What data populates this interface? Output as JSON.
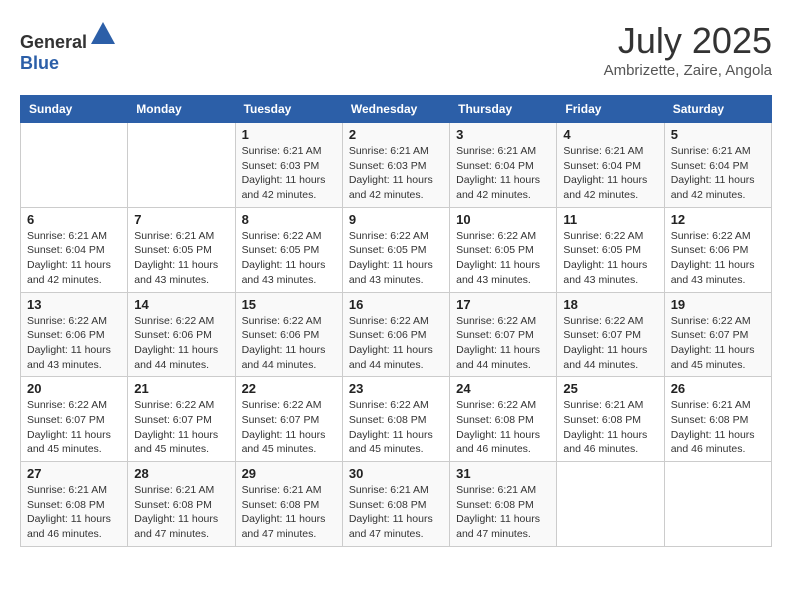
{
  "header": {
    "logo_general": "General",
    "logo_blue": "Blue",
    "month_year": "July 2025",
    "location": "Ambrizette, Zaire, Angola"
  },
  "columns": [
    "Sunday",
    "Monday",
    "Tuesday",
    "Wednesday",
    "Thursday",
    "Friday",
    "Saturday"
  ],
  "weeks": [
    [
      {
        "day": "",
        "info": ""
      },
      {
        "day": "",
        "info": ""
      },
      {
        "day": "1",
        "info": "Sunrise: 6:21 AM\nSunset: 6:03 PM\nDaylight: 11 hours and 42 minutes."
      },
      {
        "day": "2",
        "info": "Sunrise: 6:21 AM\nSunset: 6:03 PM\nDaylight: 11 hours and 42 minutes."
      },
      {
        "day": "3",
        "info": "Sunrise: 6:21 AM\nSunset: 6:04 PM\nDaylight: 11 hours and 42 minutes."
      },
      {
        "day": "4",
        "info": "Sunrise: 6:21 AM\nSunset: 6:04 PM\nDaylight: 11 hours and 42 minutes."
      },
      {
        "day": "5",
        "info": "Sunrise: 6:21 AM\nSunset: 6:04 PM\nDaylight: 11 hours and 42 minutes."
      }
    ],
    [
      {
        "day": "6",
        "info": "Sunrise: 6:21 AM\nSunset: 6:04 PM\nDaylight: 11 hours and 42 minutes."
      },
      {
        "day": "7",
        "info": "Sunrise: 6:21 AM\nSunset: 6:05 PM\nDaylight: 11 hours and 43 minutes."
      },
      {
        "day": "8",
        "info": "Sunrise: 6:22 AM\nSunset: 6:05 PM\nDaylight: 11 hours and 43 minutes."
      },
      {
        "day": "9",
        "info": "Sunrise: 6:22 AM\nSunset: 6:05 PM\nDaylight: 11 hours and 43 minutes."
      },
      {
        "day": "10",
        "info": "Sunrise: 6:22 AM\nSunset: 6:05 PM\nDaylight: 11 hours and 43 minutes."
      },
      {
        "day": "11",
        "info": "Sunrise: 6:22 AM\nSunset: 6:05 PM\nDaylight: 11 hours and 43 minutes."
      },
      {
        "day": "12",
        "info": "Sunrise: 6:22 AM\nSunset: 6:06 PM\nDaylight: 11 hours and 43 minutes."
      }
    ],
    [
      {
        "day": "13",
        "info": "Sunrise: 6:22 AM\nSunset: 6:06 PM\nDaylight: 11 hours and 43 minutes."
      },
      {
        "day": "14",
        "info": "Sunrise: 6:22 AM\nSunset: 6:06 PM\nDaylight: 11 hours and 44 minutes."
      },
      {
        "day": "15",
        "info": "Sunrise: 6:22 AM\nSunset: 6:06 PM\nDaylight: 11 hours and 44 minutes."
      },
      {
        "day": "16",
        "info": "Sunrise: 6:22 AM\nSunset: 6:06 PM\nDaylight: 11 hours and 44 minutes."
      },
      {
        "day": "17",
        "info": "Sunrise: 6:22 AM\nSunset: 6:07 PM\nDaylight: 11 hours and 44 minutes."
      },
      {
        "day": "18",
        "info": "Sunrise: 6:22 AM\nSunset: 6:07 PM\nDaylight: 11 hours and 44 minutes."
      },
      {
        "day": "19",
        "info": "Sunrise: 6:22 AM\nSunset: 6:07 PM\nDaylight: 11 hours and 45 minutes."
      }
    ],
    [
      {
        "day": "20",
        "info": "Sunrise: 6:22 AM\nSunset: 6:07 PM\nDaylight: 11 hours and 45 minutes."
      },
      {
        "day": "21",
        "info": "Sunrise: 6:22 AM\nSunset: 6:07 PM\nDaylight: 11 hours and 45 minutes."
      },
      {
        "day": "22",
        "info": "Sunrise: 6:22 AM\nSunset: 6:07 PM\nDaylight: 11 hours and 45 minutes."
      },
      {
        "day": "23",
        "info": "Sunrise: 6:22 AM\nSunset: 6:08 PM\nDaylight: 11 hours and 45 minutes."
      },
      {
        "day": "24",
        "info": "Sunrise: 6:22 AM\nSunset: 6:08 PM\nDaylight: 11 hours and 46 minutes."
      },
      {
        "day": "25",
        "info": "Sunrise: 6:21 AM\nSunset: 6:08 PM\nDaylight: 11 hours and 46 minutes."
      },
      {
        "day": "26",
        "info": "Sunrise: 6:21 AM\nSunset: 6:08 PM\nDaylight: 11 hours and 46 minutes."
      }
    ],
    [
      {
        "day": "27",
        "info": "Sunrise: 6:21 AM\nSunset: 6:08 PM\nDaylight: 11 hours and 46 minutes."
      },
      {
        "day": "28",
        "info": "Sunrise: 6:21 AM\nSunset: 6:08 PM\nDaylight: 11 hours and 47 minutes."
      },
      {
        "day": "29",
        "info": "Sunrise: 6:21 AM\nSunset: 6:08 PM\nDaylight: 11 hours and 47 minutes."
      },
      {
        "day": "30",
        "info": "Sunrise: 6:21 AM\nSunset: 6:08 PM\nDaylight: 11 hours and 47 minutes."
      },
      {
        "day": "31",
        "info": "Sunrise: 6:21 AM\nSunset: 6:08 PM\nDaylight: 11 hours and 47 minutes."
      },
      {
        "day": "",
        "info": ""
      },
      {
        "day": "",
        "info": ""
      }
    ]
  ]
}
